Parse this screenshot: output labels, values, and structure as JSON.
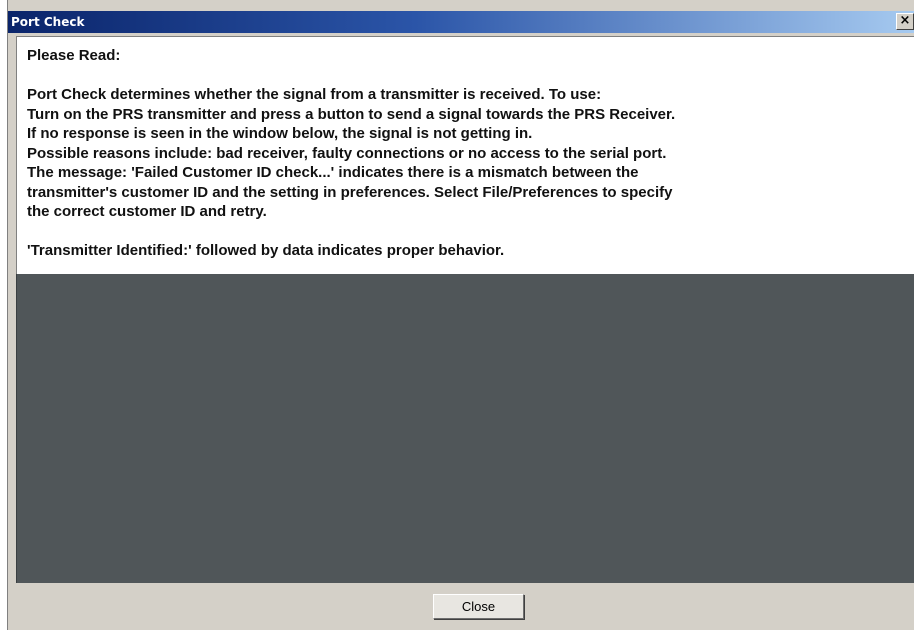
{
  "window": {
    "title": "Port Check",
    "close_glyph": "×"
  },
  "info": {
    "heading": "Please Read:",
    "lines": [
      "Port Check determines whether the signal from a transmitter is received. To use:",
      "Turn on the PRS transmitter and press a button to send a signal towards the PRS Receiver.",
      "If no response is seen in the window below, the signal is not getting in.",
      "Possible reasons include: bad receiver, faulty connections or no access to the serial port.",
      "The message: 'Failed Customer ID check...' indicates there is a mismatch between the",
      "transmitter's customer ID and the setting in preferences. Select File/Preferences to specify",
      "the correct customer ID and retry."
    ],
    "footer": "'Transmitter Identified:' followed by data indicates proper behavior."
  },
  "buttons": {
    "close_label": "Close"
  },
  "colors": {
    "title_bar_start": "#0a246a",
    "title_bar_end": "#a6caf0",
    "output_background": "#505659",
    "dialog_background": "#d4d0c8"
  }
}
